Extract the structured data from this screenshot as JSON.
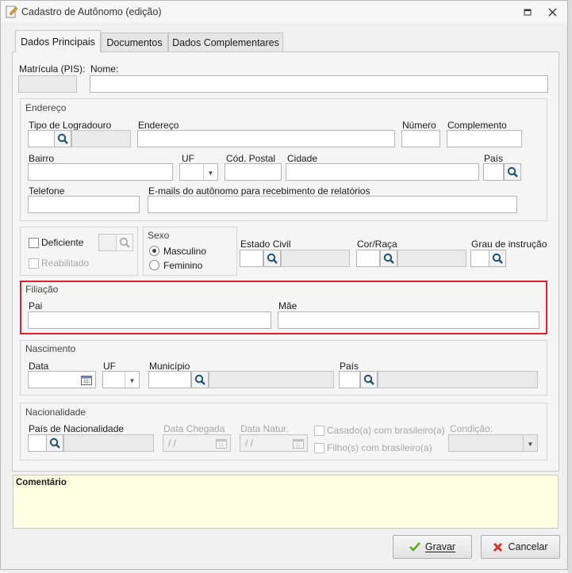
{
  "window": {
    "title": "Cadastro de Autônomo (edição)",
    "restore_icon": "restore-icon",
    "close_icon": "close-icon"
  },
  "tabs": [
    {
      "label": "Dados Principais",
      "active": true
    },
    {
      "label": "Documentos",
      "active": false
    },
    {
      "label": "Dados Complementares",
      "active": false
    }
  ],
  "identificacao": {
    "matricula_label": "Matrícula (PIS):",
    "nome_label": "Nome:"
  },
  "endereco": {
    "group_title": "Endereço",
    "tipo_logradouro_label": "Tipo de Logradouro",
    "endereco_label": "Endereço",
    "numero_label": "Número",
    "complemento_label": "Complemento",
    "bairro_label": "Bairro",
    "uf_label": "UF",
    "cod_postal_label": "Cód. Postal",
    "cidade_label": "Cidade",
    "pais_label": "País",
    "telefone_label": "Telefone",
    "emails_label": "E-mails do autônomo para recebimento de relatórios"
  },
  "deficiencia": {
    "deficiente_label": "Deficiente",
    "reabilitado_label": "Reabilitado"
  },
  "sexo": {
    "group_title": "Sexo",
    "options": [
      "Masculino",
      "Feminino"
    ],
    "selected": "Masculino"
  },
  "pessoal": {
    "estado_civil_label": "Estado Civil",
    "cor_raca_label": "Cor/Raça",
    "grau_instrucao_label": "Grau de instrução"
  },
  "filiacao": {
    "group_title": "Filiação",
    "pai_label": "Pai",
    "mae_label": "Mãe",
    "highlight_color": "#e0202a"
  },
  "nascimento": {
    "group_title": "Nascimento",
    "data_label": "Data",
    "uf_label": "UF",
    "municipio_label": "Município",
    "pais_label": "País"
  },
  "nacionalidade": {
    "group_title": "Nacionalidade",
    "pais_nacionalidade_label": "País de Nacionalidade",
    "data_chegada_label": "Data Chegada",
    "data_chegada_value": "/ /",
    "data_natur_label": "Data Natur.",
    "data_natur_value": "/ /",
    "casado_label": "Casado(a) com brasileiro(a)",
    "filhos_label": "Filho(s) com brasileiro(a)",
    "condicao_label": "Condição:"
  },
  "comentario": {
    "label": "Comentário",
    "background": "#ffffe1"
  },
  "buttons": {
    "gravar_label": "Gravar",
    "cancelar_label": "Cancelar"
  }
}
